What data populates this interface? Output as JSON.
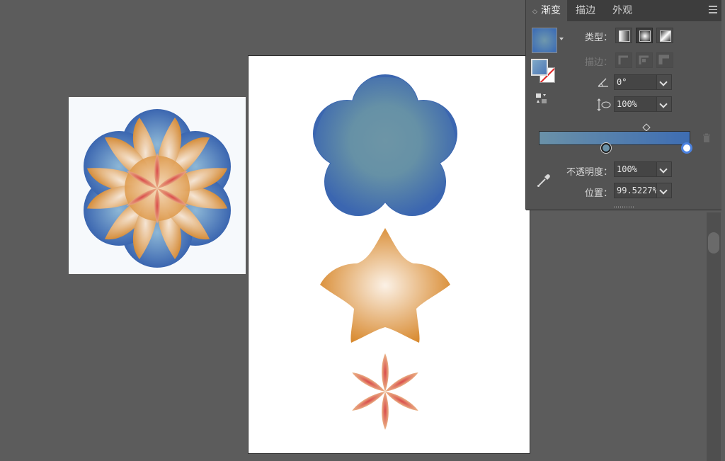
{
  "panel": {
    "tabs": [
      {
        "label": "渐变",
        "active": true
      },
      {
        "label": "描边",
        "active": false
      },
      {
        "label": "外观",
        "active": false
      }
    ],
    "type_label": "类型：",
    "stroke_label": "描边：",
    "angle_value": "0°",
    "aspect_value": "100%",
    "opacity_label": "不透明度：",
    "opacity_value": "100%",
    "position_label": "位置：",
    "position_value": "99.5227%",
    "gradient": {
      "start_color": "#6a91a8",
      "end_color": "#3e6db3",
      "selected_stop": "right"
    }
  },
  "colors": {
    "workspace_bg": "#5c5c5c",
    "panel_bg": "#535353",
    "blue_flower_edge": "#3b66b0",
    "blue_flower_center": "#6d95a6",
    "orange_flower_edge": "#d8892e",
    "orange_flower_center": "#fbe9d6",
    "red_flower_center": "#d94a4a",
    "red_flower_edge": "#e6b07c"
  }
}
